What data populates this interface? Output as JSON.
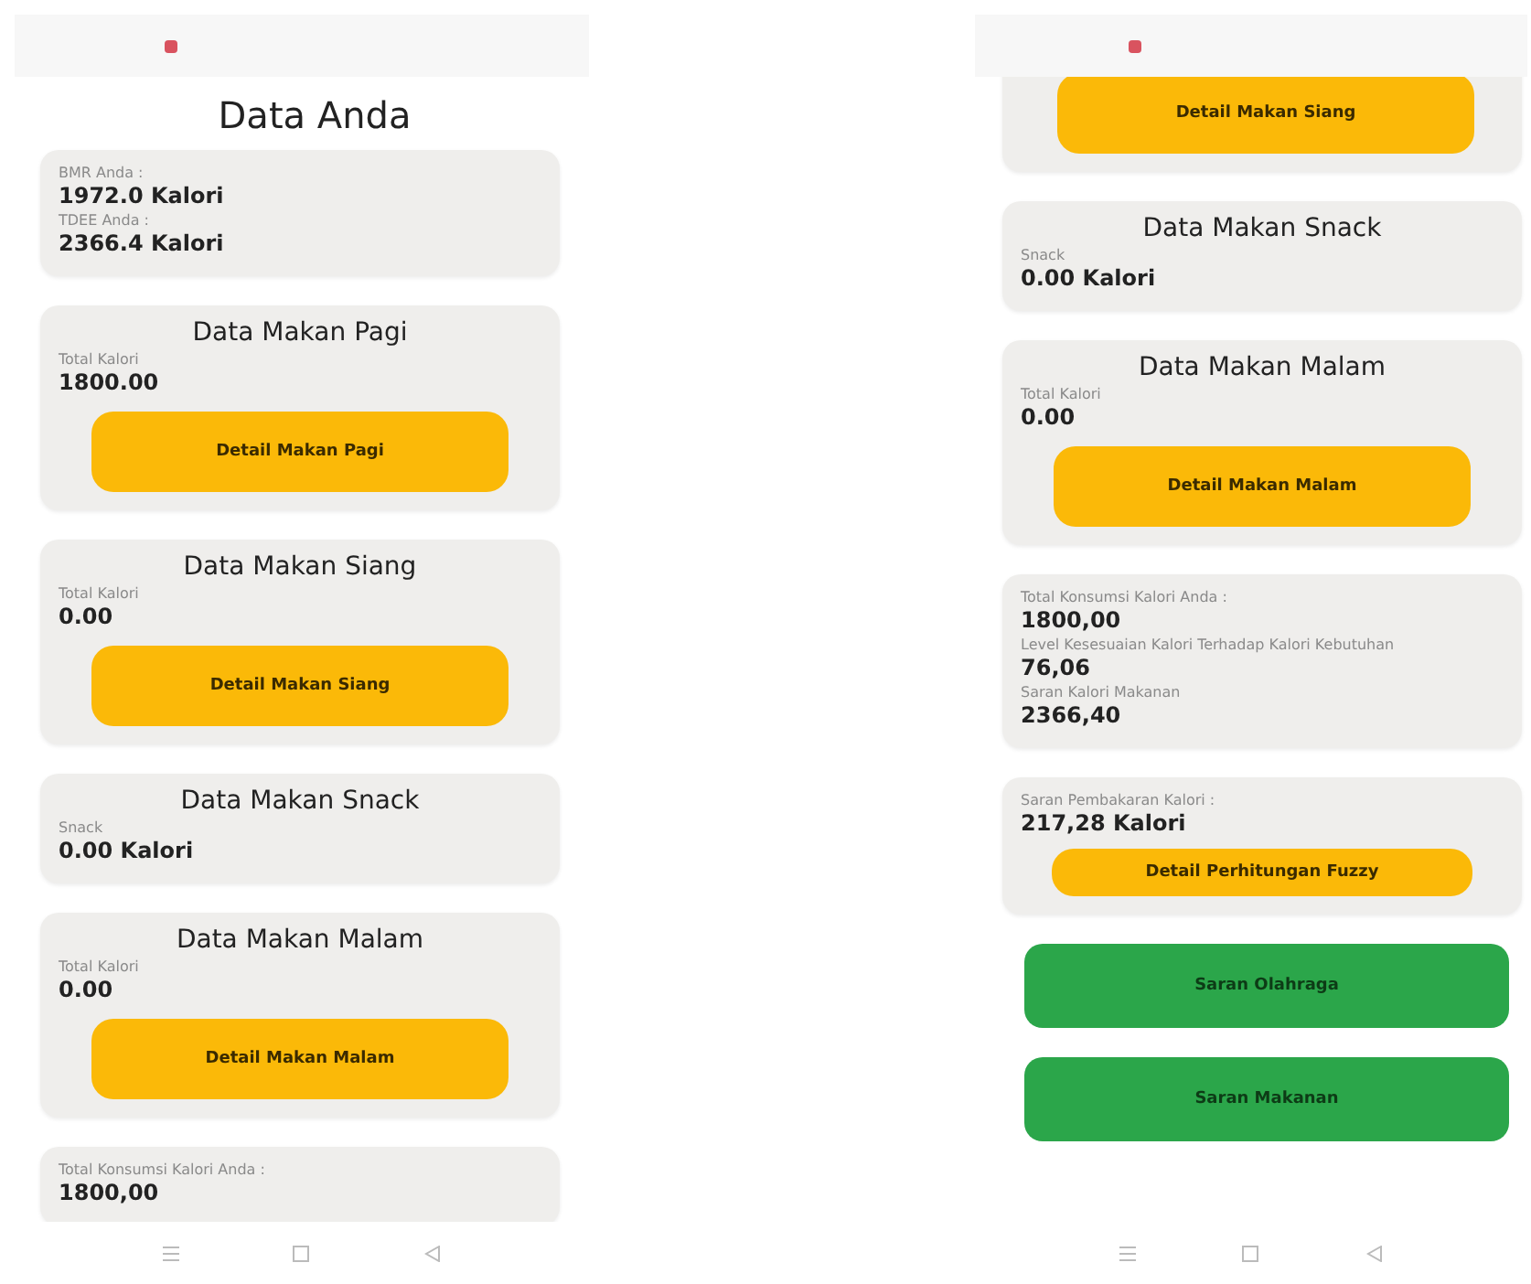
{
  "screens": [
    {
      "items": [
        {
          "kind": "title",
          "text": "Data Anda"
        },
        {
          "kind": "card",
          "fields": [
            {
              "label": "BMR Anda :",
              "value": "1972.0 Kalori"
            },
            {
              "label": "TDEE Anda :",
              "value": "2366.4 Kalori"
            }
          ]
        },
        {
          "kind": "card",
          "heading": "Data Makan Pagi",
          "fields": [
            {
              "label": "Total Kalori",
              "value": "1800.00"
            }
          ],
          "button": "Detail Makan Pagi"
        },
        {
          "kind": "card",
          "heading": "Data Makan Siang",
          "fields": [
            {
              "label": "Total Kalori",
              "value": "0.00"
            }
          ],
          "button": "Detail Makan Siang"
        },
        {
          "kind": "card",
          "heading": "Data Makan Snack",
          "fields": [
            {
              "label": "Snack",
              "value": "0.00 Kalori"
            }
          ]
        },
        {
          "kind": "card",
          "heading": "Data Makan Malam",
          "fields": [
            {
              "label": "Total Kalori",
              "value": "0.00"
            }
          ],
          "button": "Detail Makan Malam"
        },
        {
          "kind": "card",
          "fields": [
            {
              "label": "Total Konsumsi Kalori Anda :",
              "value": "1800,00"
            }
          ]
        }
      ]
    },
    {
      "items": [
        {
          "kind": "card",
          "cut": true,
          "button": "Detail Makan Siang"
        },
        {
          "kind": "card",
          "heading": "Data Makan Snack",
          "fields": [
            {
              "label": "Snack",
              "value": "0.00 Kalori"
            }
          ]
        },
        {
          "kind": "card",
          "heading": "Data Makan Malam",
          "fields": [
            {
              "label": "Total Kalori",
              "value": "0.00"
            }
          ],
          "button": "Detail Makan Malam"
        },
        {
          "kind": "card",
          "fields": [
            {
              "label": "Total Konsumsi Kalori Anda :",
              "value": "1800,00"
            },
            {
              "label": "Level Kesesuaian Kalori Terhadap Kalori Kebutuhan",
              "value": "76,06"
            },
            {
              "label": "Saran Kalori Makanan",
              "value": "2366,40"
            }
          ]
        },
        {
          "kind": "card",
          "fields": [
            {
              "label": "Saran Pembakaran Kalori :",
              "value": "217,28 Kalori"
            }
          ],
          "button": "Detail Perhitungan Fuzzy",
          "small": true
        },
        {
          "kind": "action",
          "text": "Saran Olahraga"
        },
        {
          "kind": "action",
          "text": "Saran Makanan"
        }
      ]
    }
  ]
}
